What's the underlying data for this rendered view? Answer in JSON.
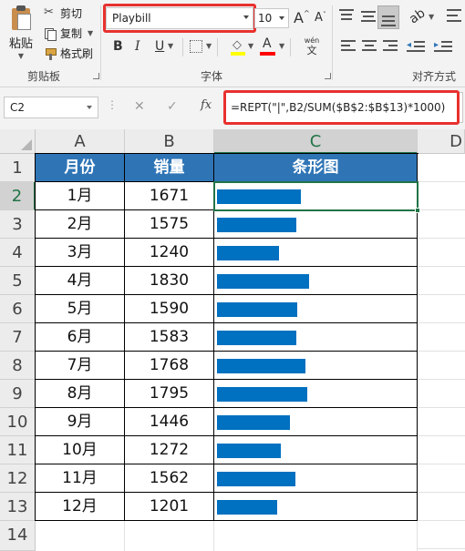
{
  "ribbon": {
    "clipboard": {
      "paste": "粘贴",
      "cut": "剪切",
      "copy": "复制",
      "format_painter": "格式刷",
      "group_label": "剪贴板"
    },
    "font": {
      "font_name": "Playbill",
      "font_size": "10",
      "grow_label": "A",
      "shrink_label": "A",
      "bold": "B",
      "italic": "I",
      "underline": "U",
      "font_color_label": "A",
      "phonetic_top": "wén",
      "phonetic_bottom": "文",
      "group_label": "字体"
    },
    "alignment": {
      "group_label": "对齐方式"
    },
    "colors": {
      "fill_color": "#ffff00",
      "font_color": "#ff0000",
      "highlight": "#e8312f"
    }
  },
  "formula_bar": {
    "name_box": "C2",
    "fx": "fx",
    "cancel": "✕",
    "enter": "✓",
    "formula": "=REPT(\"|\",B2/SUM($B$2:$B$13)*1000)"
  },
  "sheet": {
    "columns": [
      "A",
      "B",
      "C",
      "D"
    ],
    "row_numbers": [
      "1",
      "2",
      "3",
      "4",
      "5",
      "6",
      "7",
      "8",
      "9",
      "10",
      "11",
      "12",
      "13",
      "14"
    ],
    "headers": {
      "month": "月份",
      "sales": "销量",
      "bar": "条形图"
    },
    "rows": [
      {
        "month": "1月",
        "sales": "1671",
        "value": 1671
      },
      {
        "month": "2月",
        "sales": "1575",
        "value": 1575
      },
      {
        "month": "3月",
        "sales": "1240",
        "value": 1240
      },
      {
        "month": "4月",
        "sales": "1830",
        "value": 1830
      },
      {
        "month": "5月",
        "sales": "1590",
        "value": 1590
      },
      {
        "month": "6月",
        "sales": "1583",
        "value": 1583
      },
      {
        "month": "7月",
        "sales": "1768",
        "value": 1768
      },
      {
        "month": "8月",
        "sales": "1795",
        "value": 1795
      },
      {
        "month": "9月",
        "sales": "1446",
        "value": 1446
      },
      {
        "month": "10月",
        "sales": "1272",
        "value": 1272
      },
      {
        "month": "11月",
        "sales": "1562",
        "value": 1562
      },
      {
        "month": "12月",
        "sales": "1201",
        "value": 1201
      }
    ],
    "header_fill": "#2f75b6",
    "bar_color": "#0070c0",
    "selection_color": "#217346"
  }
}
